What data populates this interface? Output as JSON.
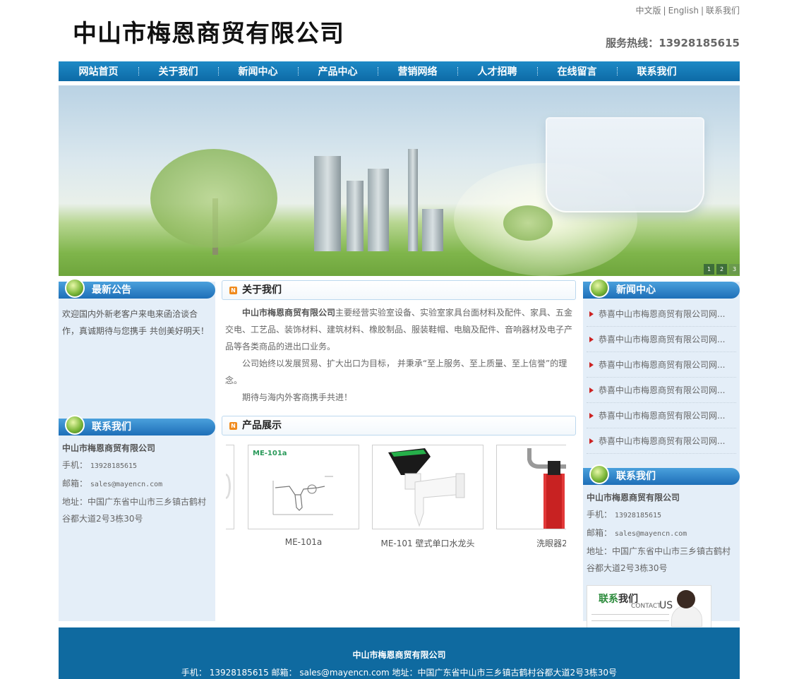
{
  "header": {
    "top_links": [
      "中文版",
      "English",
      "联系我们"
    ],
    "separator": "|",
    "logo_text": "中山市梅恩商贸有限公司",
    "hotline_label": "服务热线：",
    "hotline_number": "13928185615"
  },
  "nav": {
    "items": [
      "网站首页",
      "关于我们",
      "新闻中心",
      "产品中心",
      "营销网络",
      "人才招聘",
      "在线留言",
      "联系我们"
    ]
  },
  "banner": {
    "slide_numbers": [
      "1",
      "2",
      "3"
    ],
    "active_slide": "3"
  },
  "left": {
    "notice_title": "最新公告",
    "notice_text": "欢迎国内外新老客户来电来函洽谈合作，真诚期待与您携手 共创美好明天！",
    "contact_title": "联系我们",
    "company": "中山市梅恩商贸有限公司",
    "phone_label": "手机：",
    "phone": "13928185615",
    "email_label": "邮箱：",
    "email": "sales@mayencn.com",
    "address_label": "地址：",
    "address": "中国广东省中山市三乡镇古鹤村谷都大道2号3栋30号"
  },
  "about": {
    "title": "关于我们",
    "company_bold": "中山市梅恩商贸有限公司",
    "p1_rest": "主要经营实验室设备、实验室家具台面材料及配件、家具、五金交电、工艺品、装饰材料、建筑材料、橡胶制品、服装鞋帽、电脑及配件、音响器材及电子产品等各类商品的进出口业务。",
    "p2": "公司始终以发展贸易、扩大出口为目标， 并秉承“至上服务、至上质量、至上信誉”的理念。",
    "p3": "期待与海内外客商携手共进！"
  },
  "products": {
    "title": "产品展示",
    "items": [
      {
        "name": "ME-101a",
        "image_label": "ME-101a"
      },
      {
        "name": "ME-101 壁式单口水龙头"
      },
      {
        "name": "洗眼器2"
      }
    ]
  },
  "right": {
    "news_title": "新闻中心",
    "news_items": [
      "恭喜中山市梅恩商贸有限公司网...",
      "恭喜中山市梅恩商贸有限公司网...",
      "恭喜中山市梅恩商贸有限公司网...",
      "恭喜中山市梅恩商贸有限公司网...",
      "恭喜中山市梅恩商贸有限公司网...",
      "恭喜中山市梅恩商贸有限公司网..."
    ],
    "contact_title": "联系我们",
    "company": "中山市梅恩商贸有限公司",
    "phone_label": "手机：",
    "phone": "13928185615",
    "email_label": "邮箱：",
    "email": "sales@mayencn.com",
    "address_label": "地址：",
    "address": "中国广东省中山市三乡镇古鹤村谷都大道2号3栋30号",
    "contact_image": {
      "cn_green": "联系",
      "cn_black": "我们",
      "en_small": "CONTACT",
      "en_big": "US"
    }
  },
  "footer": {
    "company": "中山市梅恩商贸有限公司",
    "contact_line": "手机： 13928185615   邮箱： sales@mayencn.com   地址：中国广东省中山市三乡镇古鹤村谷都大道2号3栋30号"
  },
  "colors": {
    "nav_blue": "#1e8ac6",
    "footer_blue": "#0f6aa0",
    "side_bg": "#e4eef8",
    "accent_orange": "#f08a1c",
    "arrow_red": "#cc2222"
  }
}
